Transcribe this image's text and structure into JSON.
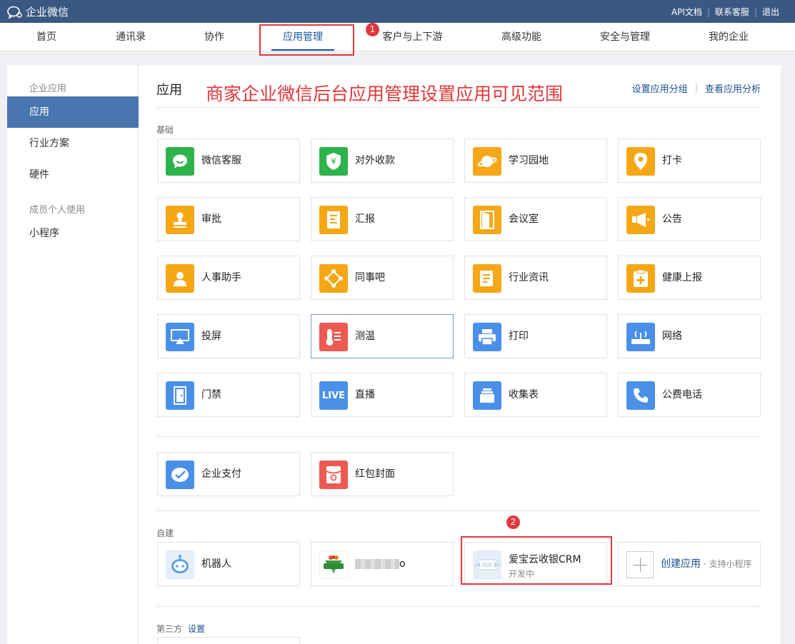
{
  "topbar": {
    "brand": "企业微信",
    "links": [
      "API文档",
      "联系客服",
      "退出"
    ],
    "separator": "|"
  },
  "nav": {
    "items": [
      "首页",
      "通讯录",
      "协作",
      "应用管理",
      "客户与上下游",
      "高级功能",
      "安全与管理",
      "我的企业"
    ],
    "active": "应用管理"
  },
  "annotations": {
    "marker1": "1",
    "marker2": "2",
    "title": "商家企业微信后台应用管理设置应用可见范围"
  },
  "sidebar": {
    "group1": "企业应用",
    "items1": [
      "应用",
      "行业方案",
      "硬件"
    ],
    "group2": "成员个人使用",
    "items2": [
      "小程序"
    ],
    "active": "应用"
  },
  "main": {
    "title": "应用",
    "links": [
      "设置应用分组",
      "查看应用分析"
    ]
  },
  "sections": {
    "basic": "基础",
    "custom": "自建",
    "third_party": "第三方",
    "third_party_link": "设置"
  },
  "basic_apps": [
    {
      "label": "微信客服",
      "icon": "wechat-service-icon",
      "color": "#2eb24c"
    },
    {
      "label": "对外收款",
      "icon": "yuan-shield-icon",
      "color": "#2eb24c"
    },
    {
      "label": "学习园地",
      "icon": "planet-icon",
      "color": "#f5a716"
    },
    {
      "label": "打卡",
      "icon": "location-pin-icon",
      "color": "#f5a716"
    },
    {
      "label": "审批",
      "icon": "stamp-icon",
      "color": "#f5a716"
    },
    {
      "label": "汇报",
      "icon": "report-doc-icon",
      "color": "#f5a716"
    },
    {
      "label": "会议室",
      "icon": "door-icon",
      "color": "#f5a716"
    },
    {
      "label": "公告",
      "icon": "megaphone-icon",
      "color": "#f5a716"
    },
    {
      "label": "人事助手",
      "icon": "person-badge-icon",
      "color": "#f5a716"
    },
    {
      "label": "同事吧",
      "icon": "network-icon",
      "color": "#f5a716"
    },
    {
      "label": "行业资讯",
      "icon": "news-icon",
      "color": "#f5a716"
    },
    {
      "label": "健康上报",
      "icon": "health-clipboard-icon",
      "color": "#f5a716"
    },
    {
      "label": "投屏",
      "icon": "screencast-icon",
      "color": "#4a90e8"
    },
    {
      "label": "测温",
      "icon": "thermometer-icon",
      "color": "#ec5a52"
    },
    {
      "label": "打印",
      "icon": "printer-icon",
      "color": "#4a90e8"
    },
    {
      "label": "网络",
      "icon": "router-icon",
      "color": "#4a90e8"
    },
    {
      "label": "门禁",
      "icon": "access-door-icon",
      "color": "#4a90e8"
    },
    {
      "label": "直播",
      "icon": "live-icon",
      "color": "#4a90e8",
      "icon_text": "LIVE"
    },
    {
      "label": "收集表",
      "icon": "form-stack-icon",
      "color": "#4a90e8"
    },
    {
      "label": "公费电话",
      "icon": "phone-icon",
      "color": "#4a90e8"
    }
  ],
  "extra_apps": [
    {
      "label": "企业支付",
      "icon": "enterprise-pay-icon",
      "color": "#4a90e8"
    },
    {
      "label": "红包封面",
      "icon": "red-packet-icon",
      "color": "#ec5a52"
    }
  ],
  "custom_apps": [
    {
      "label": "机器人",
      "icon": "robot-icon"
    },
    {
      "label": "o",
      "icon": "custom-app-logo-icon",
      "logo_text": "生鲜"
    },
    {
      "label": "爱宝云收银CRM",
      "sub": "开发中",
      "icon": "crm-logo-icon"
    },
    {
      "label": "创建应用",
      "hint": " · 支持小程序",
      "icon": "plus-icon"
    }
  ]
}
